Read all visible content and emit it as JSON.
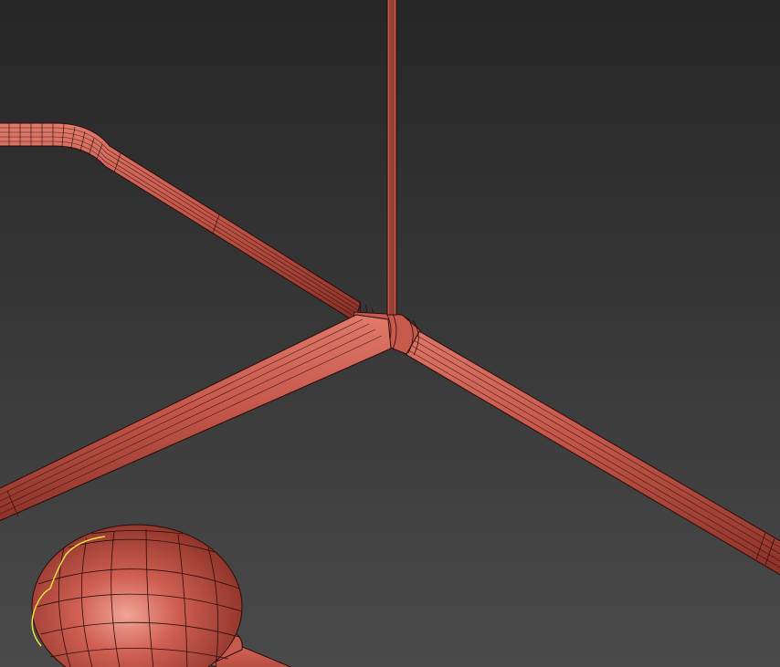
{
  "viewport": {
    "background_top": "#262626",
    "background_bottom": "#4a4a4a",
    "mesh_color": "#c4574a",
    "mesh_highlight": "#e07a6a",
    "mesh_shadow": "#8a3128",
    "wire_color": "#2a0c08",
    "selection_color": "#e8e840"
  },
  "scene_objects": [
    "curved-pipe",
    "vertical-rod",
    "diagonal-pipe",
    "branch-pipe",
    "pipe-junction",
    "sphere-fitting"
  ]
}
